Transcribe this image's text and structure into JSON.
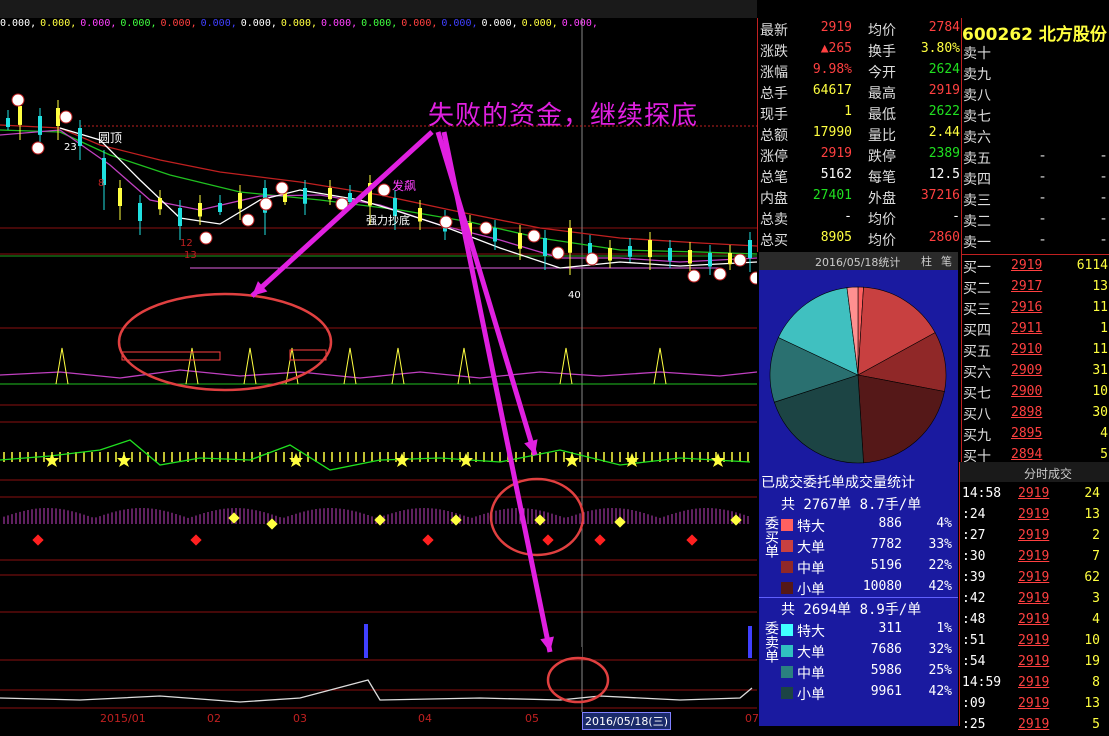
{
  "indicator_values": [
    "0.000",
    "0.000",
    "0.000",
    "0.000",
    "0.000",
    "0.000",
    "0.000",
    "0.000",
    "0.000",
    "0.000",
    "0.000",
    "0.000",
    "0.000",
    "0.000",
    "0.000"
  ],
  "annotation_text": "失败的资金，继续探底",
  "chart_labels": {
    "top_label": "圆顶",
    "fafeng": "发飙",
    "rise_label": "强力抄底",
    "small_23": "23",
    "small_8": "8",
    "small_12": "12",
    "small_13": "13",
    "small_40": "40"
  },
  "x_axis": {
    "labels": [
      "2015/01",
      "02",
      "03",
      "04",
      "05",
      "07"
    ],
    "cursor_date": "2016/05/18(三)"
  },
  "stock": {
    "code": "600262",
    "name": "北方股份"
  },
  "quote": [
    {
      "l1": "最新",
      "v1": "2919",
      "c1": "red",
      "l2": "均价",
      "v2": "2784",
      "c2": "red"
    },
    {
      "l1": "涨跌",
      "v1": "▲265",
      "c1": "red",
      "l2": "换手",
      "v2": "3.80%",
      "c2": "yellow"
    },
    {
      "l1": "涨幅",
      "v1": "9.98%",
      "c1": "red",
      "l2": "今开",
      "v2": "2624",
      "c2": "green"
    },
    {
      "l1": "总手",
      "v1": "64617",
      "c1": "yellow",
      "l2": "最高",
      "v2": "2919",
      "c2": "red"
    },
    {
      "l1": "现手",
      "v1": "1",
      "c1": "yellow",
      "l2": "最低",
      "v2": "2622",
      "c2": "green"
    },
    {
      "l1": "总额",
      "v1": "17990",
      "c1": "yellow",
      "l2": "量比",
      "v2": "2.44",
      "c2": "yellow"
    },
    {
      "l1": "涨停",
      "v1": "2919",
      "c1": "red",
      "l2": "跌停",
      "v2": "2389",
      "c2": "green"
    },
    {
      "l1": "总笔",
      "v1": "5162",
      "c1": "white",
      "l2": "每笔",
      "v2": "12.5",
      "c2": "white"
    },
    {
      "l1": "内盘",
      "v1": "27401",
      "c1": "green",
      "l2": "外盘",
      "v2": "37216",
      "c2": "red"
    },
    {
      "l1": "总卖",
      "v1": "-",
      "c1": "white",
      "l2": "均价",
      "v2": "-",
      "c2": "white"
    },
    {
      "l1": "总买",
      "v1": "8905",
      "c1": "yellow",
      "l2": "均价",
      "v2": "2860",
      "c2": "red"
    }
  ],
  "sell_book": [
    {
      "label": "卖十"
    },
    {
      "label": "卖九"
    },
    {
      "label": "卖八"
    },
    {
      "label": "卖七"
    },
    {
      "label": "卖六"
    },
    {
      "label": "卖五"
    },
    {
      "label": "卖四"
    },
    {
      "label": "卖三"
    },
    {
      "label": "卖二"
    },
    {
      "label": "卖一"
    }
  ],
  "sell_dash": "-",
  "buy_book": [
    {
      "label": "买一",
      "price": "2919",
      "vol": "6114"
    },
    {
      "label": "买二",
      "price": "2917",
      "vol": "13"
    },
    {
      "label": "买三",
      "price": "2916",
      "vol": "11"
    },
    {
      "label": "买四",
      "price": "2911",
      "vol": "1"
    },
    {
      "label": "买五",
      "price": "2910",
      "vol": "11"
    },
    {
      "label": "买六",
      "price": "2909",
      "vol": "31"
    },
    {
      "label": "买七",
      "price": "2900",
      "vol": "10"
    },
    {
      "label": "买八",
      "price": "2898",
      "vol": "30"
    },
    {
      "label": "买九",
      "price": "2895",
      "vol": "4"
    },
    {
      "label": "买十",
      "price": "2894",
      "vol": "5"
    }
  ],
  "pie_panel": {
    "date": "2016/05/18统计",
    "tab_1": "柱",
    "tab_2": "笔",
    "caption": "已成交委托单成交量统计",
    "slices": [
      {
        "name": "委卖特大",
        "pct": 1,
        "color": "#ff6060"
      },
      {
        "name": "委买大单",
        "pct": 16,
        "color": "#c84040"
      },
      {
        "name": "委买中单",
        "pct": 11,
        "color": "#902828"
      },
      {
        "name": "委买小单",
        "pct": 21,
        "color": "#551818"
      },
      {
        "name": "委卖小单",
        "pct": 21,
        "color": "#1c4444"
      },
      {
        "name": "委卖中单",
        "pct": 12,
        "color": "#2a7070"
      },
      {
        "name": "委卖大单",
        "pct": 16,
        "color": "#40c0c0"
      },
      {
        "name": "委买特大",
        "pct": 2,
        "color": "#ff9090"
      }
    ]
  },
  "buy_orders": {
    "label": "委买单",
    "header": "共 2767单 8.7手/单",
    "rows": [
      {
        "name": "特大",
        "vol": "886",
        "pct": "4%",
        "color": "#ff6060"
      },
      {
        "name": "大单",
        "vol": "7782",
        "pct": "33%",
        "color": "#c84040"
      },
      {
        "name": "中单",
        "vol": "5196",
        "pct": "22%",
        "color": "#902828"
      },
      {
        "name": "小单",
        "vol": "10080",
        "pct": "42%",
        "color": "#551818"
      }
    ]
  },
  "sell_orders": {
    "label": "委卖单",
    "header": "共 2694单 8.9手/单",
    "rows": [
      {
        "name": "特大",
        "vol": "311",
        "pct": "1%",
        "color": "#40ffff"
      },
      {
        "name": "大单",
        "vol": "7686",
        "pct": "32%",
        "color": "#30c0c0"
      },
      {
        "name": "中单",
        "vol": "5986",
        "pct": "25%",
        "color": "#2a8080"
      },
      {
        "name": "小单",
        "vol": "9961",
        "pct": "42%",
        "color": "#1c4444"
      }
    ]
  },
  "ticks": {
    "title": "分时成交",
    "rows": [
      {
        "time": "14:58",
        "price": "2919",
        "vol": "24"
      },
      {
        "time": ":24",
        "price": "2919",
        "vol": "13"
      },
      {
        "time": ":27",
        "price": "2919",
        "vol": "2"
      },
      {
        "time": ":30",
        "price": "2919",
        "vol": "7"
      },
      {
        "time": ":39",
        "price": "2919",
        "vol": "62"
      },
      {
        "time": ":42",
        "price": "2919",
        "vol": "3"
      },
      {
        "time": ":48",
        "price": "2919",
        "vol": "4"
      },
      {
        "time": ":51",
        "price": "2919",
        "vol": "10"
      },
      {
        "time": ":54",
        "price": "2919",
        "vol": "19"
      },
      {
        "time": "14:59",
        "price": "2919",
        "vol": "8"
      },
      {
        "time": ":09",
        "price": "2919",
        "vol": "13"
      },
      {
        "time": ":25",
        "price": "2919",
        "vol": "5"
      }
    ]
  },
  "colors": {
    "up": "#ff4040",
    "down": "#20e020",
    "accent": "#e020e0",
    "panel_blue": "#1a1aa0"
  }
}
